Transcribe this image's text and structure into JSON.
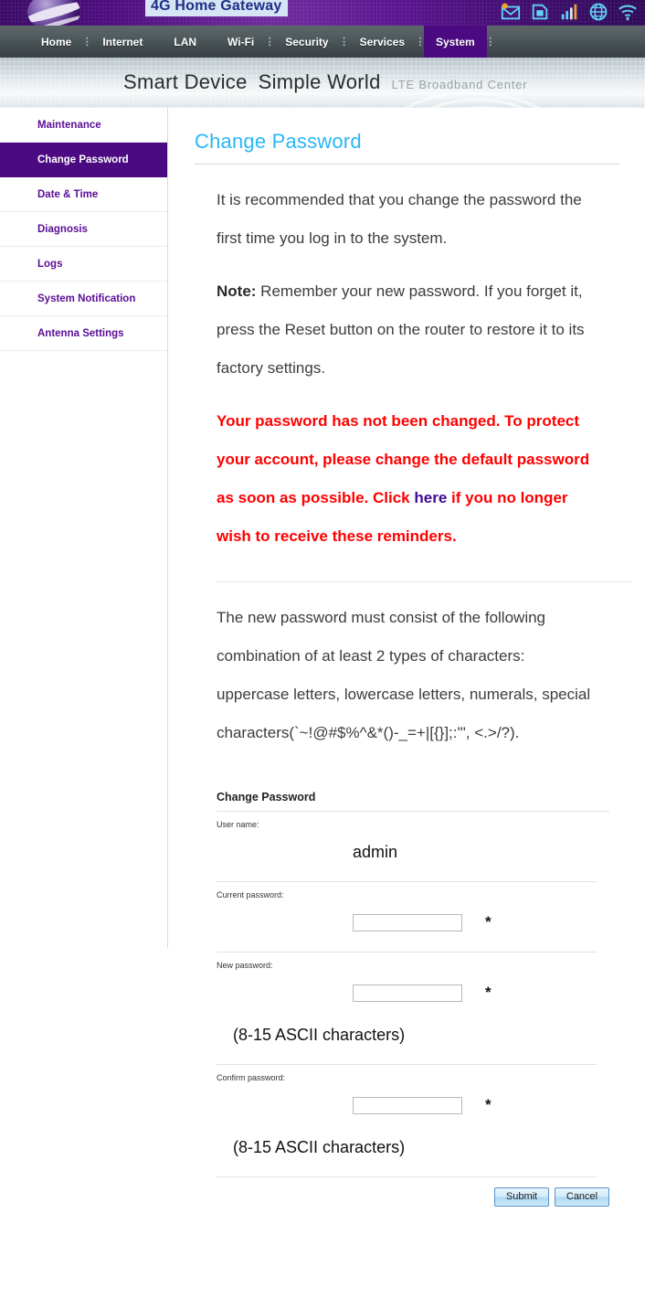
{
  "header": {
    "gateway_title": "4G Home Gateway",
    "logo_name": "telecom-globe-logo",
    "status_icons": [
      {
        "name": "sms-message-icon",
        "label": "SMS"
      },
      {
        "name": "sim-card-icon",
        "label": "SIM"
      },
      {
        "name": "signal-strength-icon",
        "label": "Signal"
      },
      {
        "name": "internet-globe-icon",
        "label": "Internet"
      },
      {
        "name": "wifi-icon",
        "label": "Wi-Fi"
      }
    ]
  },
  "nav": {
    "items": [
      {
        "label": "Home",
        "active": false
      },
      {
        "label": "Internet",
        "active": false
      },
      {
        "label": "LAN",
        "active": false
      },
      {
        "label": "Wi-Fi",
        "active": false
      },
      {
        "label": "Security",
        "active": false
      },
      {
        "label": "Services",
        "active": false
      },
      {
        "label": "System",
        "active": true
      }
    ],
    "separator": "⋮"
  },
  "banner": {
    "slogan_1": "Smart Device",
    "slogan_2": "Simple World",
    "subslogan": "LTE Broadband Center"
  },
  "sidebar": {
    "items": [
      {
        "label": "Maintenance",
        "active": false
      },
      {
        "label": "Change Password",
        "active": true
      },
      {
        "label": "Date & Time",
        "active": false
      },
      {
        "label": "Diagnosis",
        "active": false
      },
      {
        "label": "Logs",
        "active": false
      },
      {
        "label": "System Notification",
        "active": false
      },
      {
        "label": "Antenna Settings",
        "active": false
      }
    ]
  },
  "main": {
    "page_title": "Change Password",
    "intro": "It is recommended that you change the password the first time you log in to the system.",
    "note_label": "Note:",
    "note_text": " Remember your new password. If you forget it, press the Reset button on the router to restore it to its factory settings.",
    "warning_part1": "Your password has not been changed. To protect your account, please change the default password as soon as possible. Click ",
    "warning_link": "here",
    "warning_part2": " if you no longer wish to receive these reminders.",
    "requirements": "The new password must consist of the following combination of at least 2 types of characters: uppercase letters, lowercase letters, numerals, special characters(`~!@#$%^&*()-_=+|[{}];:'\", <.>/?)."
  },
  "form": {
    "title": "Change Password",
    "username_label": "User name:",
    "username_value": "admin",
    "current_label": "Current password:",
    "current_value": "",
    "new_label": "New password:",
    "new_value": "",
    "confirm_label": "Confirm password:",
    "confirm_value": "",
    "required_mark": "*",
    "length_hint": "(8-15 ASCII characters)",
    "submit_label": "Submit",
    "cancel_label": "Cancel"
  },
  "colors": {
    "brand_purple": "#4b0a82",
    "title_blue": "#29b6f6",
    "warning_red": "#ff0000",
    "link_indigo": "#3d0a94",
    "nav_grey": "#4e585b"
  }
}
